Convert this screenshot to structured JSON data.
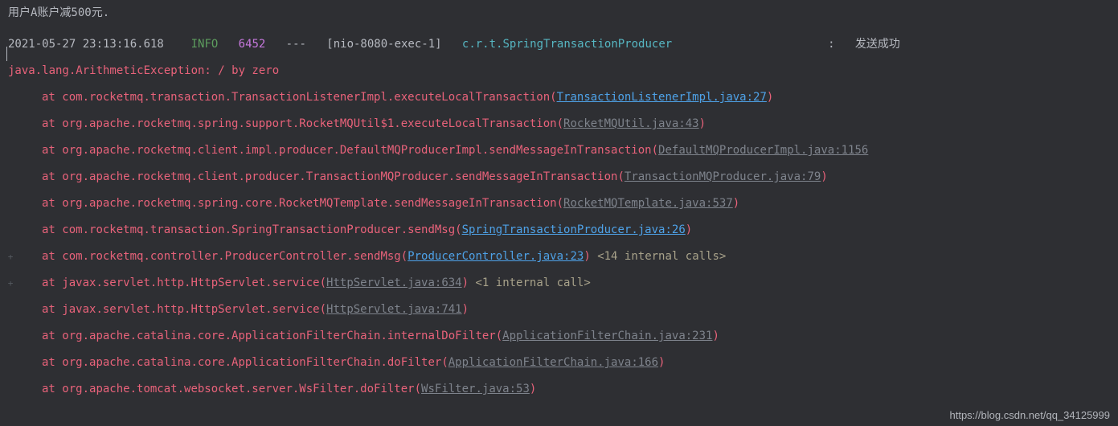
{
  "top_fragment": "用户A账户减500元.",
  "log_line": {
    "timestamp": "2021-05-27 23:13:16.618",
    "level": "INFO",
    "pid": "6452",
    "dash": "---",
    "thread": "[nio-8080-exec-1]",
    "logger": "c.r.t.SpringTransactionProducer",
    "colon": ":",
    "message": "发送成功"
  },
  "exception": "java.lang.ArithmeticException: / by zero",
  "stack": [
    {
      "at": "at ",
      "call": "com.rocketmq.transaction.TransactionListenerImpl.executeLocalTransaction",
      "open": "(",
      "link": "TransactionListenerImpl.java:27",
      "link_style": "blue",
      "close": ")",
      "after": ""
    },
    {
      "at": "at ",
      "call": "org.apache.rocketmq.spring.support.RocketMQUtil$1.executeLocalTransaction",
      "open": "(",
      "link": "RocketMQUtil.java:43",
      "link_style": "grey",
      "close": ")",
      "after": ""
    },
    {
      "at": "at ",
      "call": "org.apache.rocketmq.client.impl.producer.DefaultMQProducerImpl.sendMessageInTransaction",
      "open": "(",
      "link": "DefaultMQProducerImpl.java:1156",
      "link_style": "grey",
      "close": "",
      "after": ""
    },
    {
      "at": "at ",
      "call": "org.apache.rocketmq.client.producer.TransactionMQProducer.sendMessageInTransaction",
      "open": "(",
      "link": "TransactionMQProducer.java:79",
      "link_style": "grey",
      "close": ")",
      "after": ""
    },
    {
      "at": "at ",
      "call": "org.apache.rocketmq.spring.core.RocketMQTemplate.sendMessageInTransaction",
      "open": "(",
      "link": "RocketMQTemplate.java:537",
      "link_style": "grey",
      "close": ")",
      "after": ""
    },
    {
      "at": "at ",
      "call": "com.rocketmq.transaction.SpringTransactionProducer.sendMsg",
      "open": "(",
      "link": "SpringTransactionProducer.java:26",
      "link_style": "blue",
      "close": ")",
      "after": ""
    },
    {
      "at": "at ",
      "call": "com.rocketmq.controller.ProducerController.sendMsg",
      "open": "(",
      "link": "ProducerController.java:23",
      "link_style": "blue",
      "close": ")",
      "after": " <14 internal calls>"
    },
    {
      "at": "at ",
      "call": "javax.servlet.http.HttpServlet.service",
      "open": "(",
      "link": "HttpServlet.java:634",
      "link_style": "grey",
      "close": ")",
      "after": " <1 internal call>"
    },
    {
      "at": "at ",
      "call": "javax.servlet.http.HttpServlet.service",
      "open": "(",
      "link": "HttpServlet.java:741",
      "link_style": "grey",
      "close": ")",
      "after": ""
    },
    {
      "at": "at ",
      "call": "org.apache.catalina.core.ApplicationFilterChain.internalDoFilter",
      "open": "(",
      "link": "ApplicationFilterChain.java:231",
      "link_style": "grey",
      "close": ")",
      "after": ""
    },
    {
      "at": "at ",
      "call": "org.apache.catalina.core.ApplicationFilterChain.doFilter",
      "open": "(",
      "link": "ApplicationFilterChain.java:166",
      "link_style": "grey",
      "close": ")",
      "after": ""
    },
    {
      "at": "at ",
      "call": "org.apache.tomcat.websocket.server.WsFilter.doFilter",
      "open": "(",
      "link": "WsFilter.java:53",
      "link_style": "grey",
      "close": ")",
      "after": ""
    }
  ],
  "gutter_rows": [
    6,
    7
  ],
  "watermark": "https://blog.csdn.net/qq_34125999"
}
